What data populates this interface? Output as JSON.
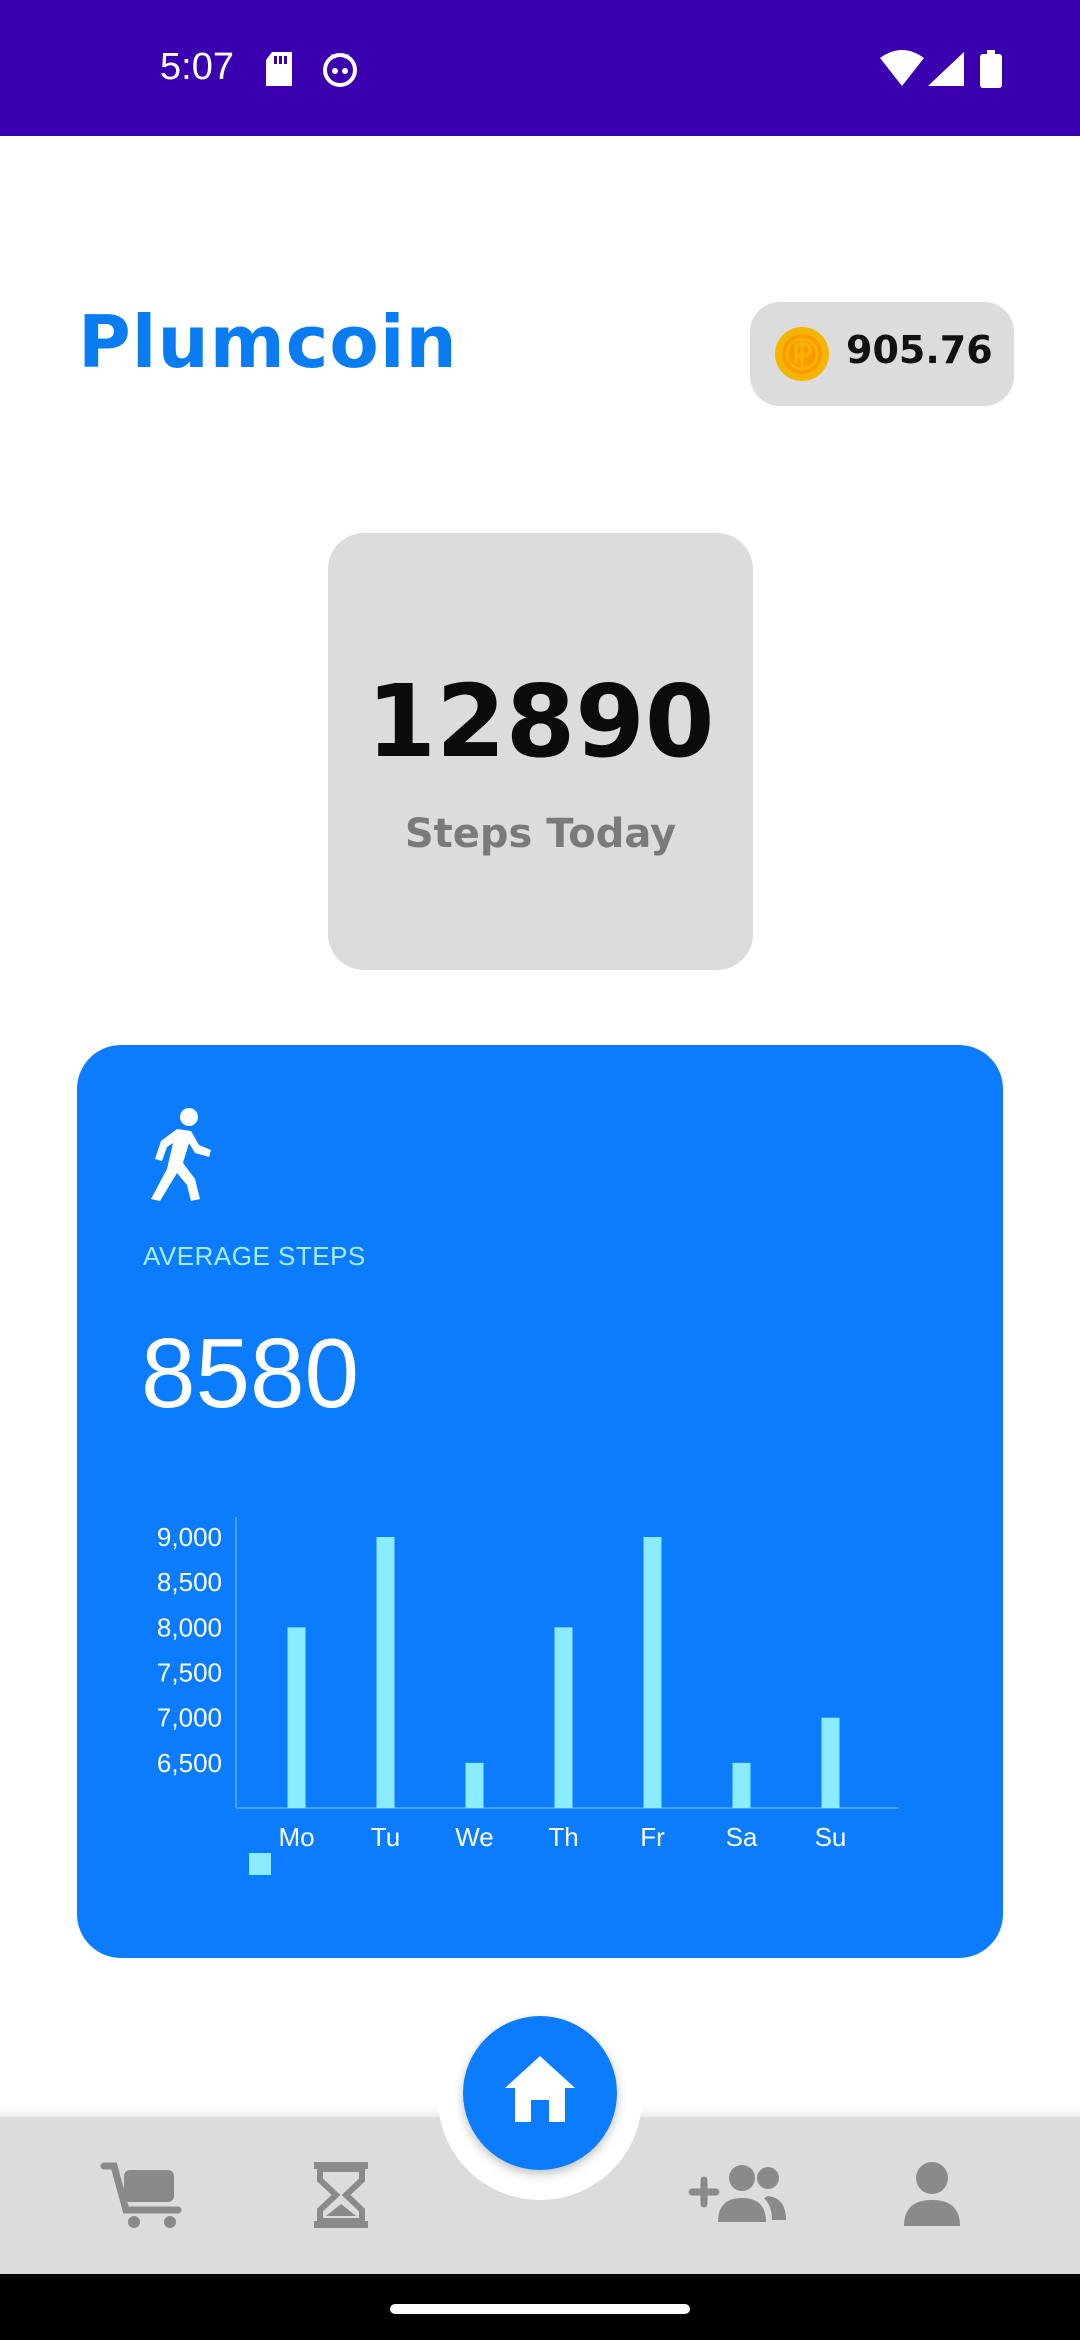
{
  "status_bar": {
    "time": "5:07",
    "left_icons": [
      "sd-card-icon",
      "cat-face-icon"
    ],
    "right_icons": [
      "wifi-icon",
      "cell-signal-icon",
      "battery-icon"
    ],
    "background": "#3a00b0"
  },
  "header": {
    "title": "Plumcoin",
    "coin_balance": "905.76",
    "title_color": "#0a7cf2"
  },
  "steps_today": {
    "value": "12890",
    "label": "Steps Today"
  },
  "average_card": {
    "label": "AVERAGE STEPS",
    "value": "8580",
    "card_color": "#0a7cfd",
    "bar_color": "#8cecff"
  },
  "chart_data": {
    "type": "bar",
    "categories": [
      "Mo",
      "Tu",
      "We",
      "Th",
      "Fr",
      "Sa",
      "Su"
    ],
    "values": [
      8000,
      9000,
      6500,
      8000,
      9000,
      6500,
      7000
    ],
    "ylim": [
      6000,
      9000
    ],
    "yticks": [
      6500,
      7000,
      7500,
      8000,
      8500,
      9000
    ],
    "ytick_labels": [
      "6,500",
      "7,000",
      "7,500",
      "8,000",
      "8,500",
      "9,000"
    ],
    "legend": "bottom-left",
    "grid": false
  },
  "bottom_nav": {
    "items": [
      {
        "icon": "cart-icon"
      },
      {
        "icon": "hourglass-icon"
      },
      {
        "icon": "home-icon"
      },
      {
        "icon": "add-friends-icon"
      },
      {
        "icon": "profile-icon"
      }
    ],
    "active": "home-icon"
  }
}
